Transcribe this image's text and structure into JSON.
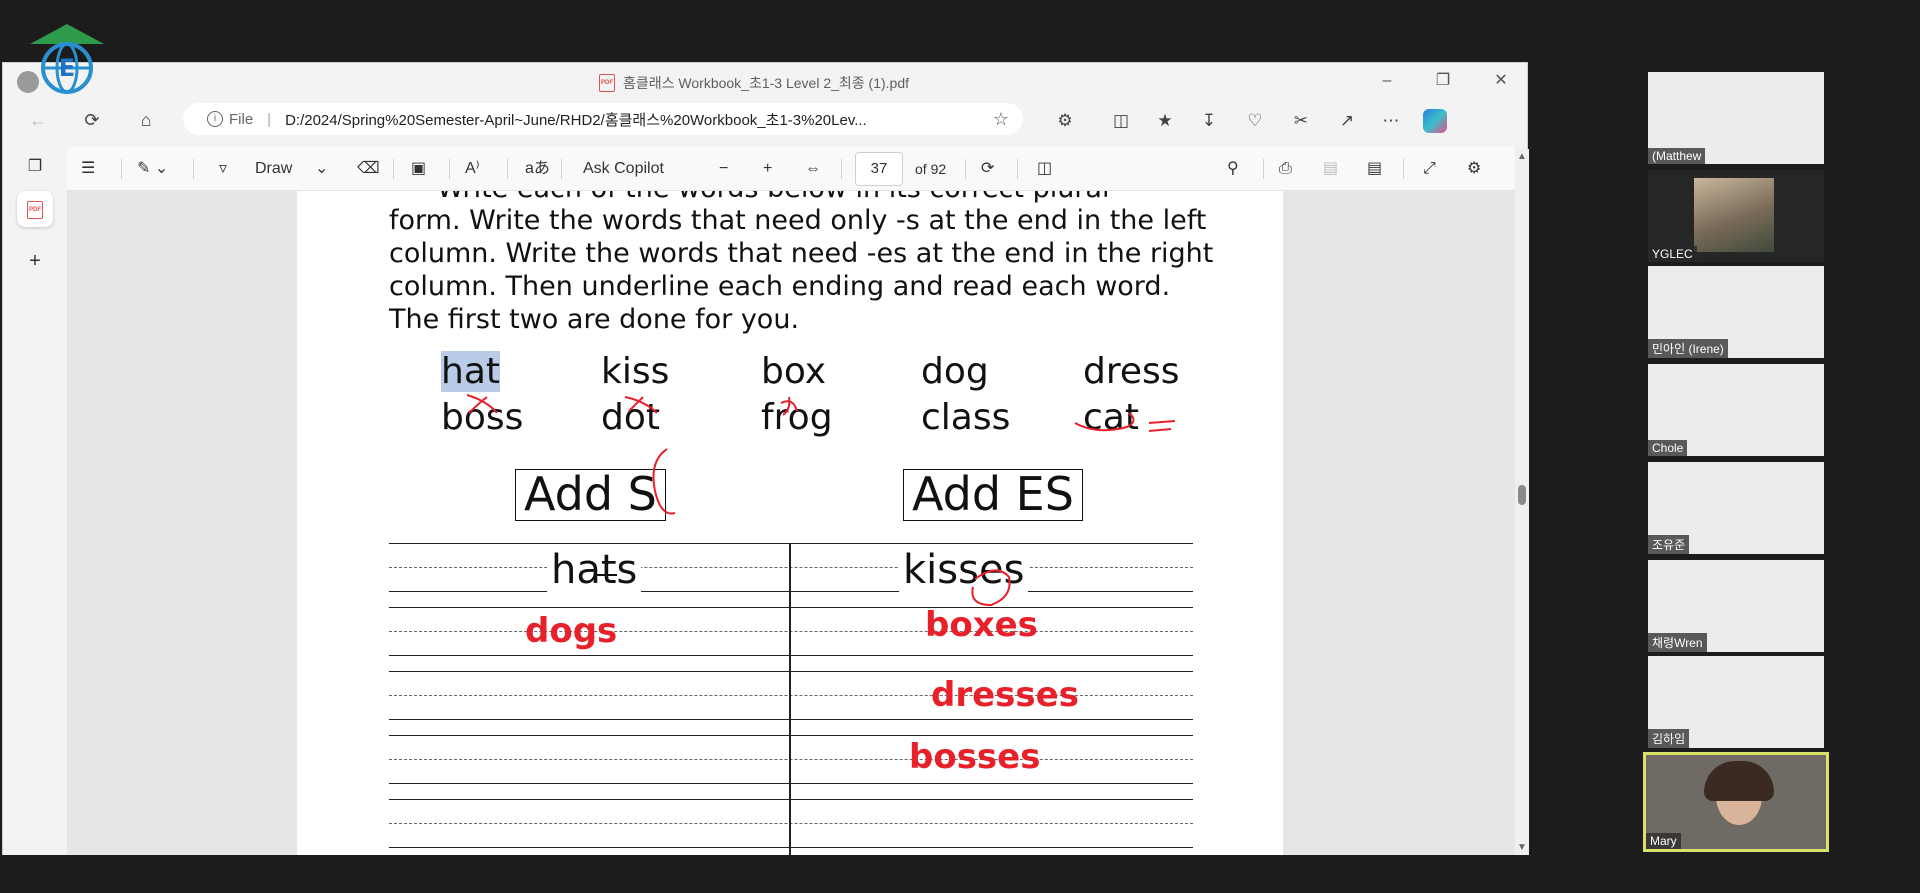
{
  "browser": {
    "tab_title": "홈클래스 Workbook_초1-3 Level 2_최종 (1).pdf",
    "url_prefix": "File",
    "url": "D:/2024/Spring%20Semester-April~June/RHD2/홈클래스%20Workbook_초1-3%20Lev..."
  },
  "pdf_toolbar": {
    "draw_label": "Draw",
    "copilot_label": "Ask Copilot",
    "page_number": "37",
    "page_total": "of 92"
  },
  "document": {
    "instructions": [
      "Write each of the words below in its correct plural",
      "form. Write the words that need only -s at the end in the left",
      "column. Write the words that need -es at the end in the right",
      "column. Then underline each ending and read each word.",
      "The first two are done for you."
    ],
    "words_row1": [
      "hat",
      "kiss",
      "box",
      "dog",
      "dress"
    ],
    "words_row2": [
      "boss",
      "dot",
      "frog",
      "class",
      "cat"
    ],
    "box_s": "Add S",
    "box_es": "Add ES",
    "example_left": "hats",
    "example_right": "kisses",
    "answers_left": [
      "dogs"
    ],
    "answers_right": [
      "boxes",
      "dresses",
      "bosses"
    ]
  },
  "participants": [
    {
      "name": "(Matthew"
    },
    {
      "name": "YGLEC"
    },
    {
      "name": "민아인 (Irene)"
    },
    {
      "name": "Chole"
    },
    {
      "name": "조유준"
    },
    {
      "name": "채령Wren"
    },
    {
      "name": "김하임"
    },
    {
      "name": "Mary"
    }
  ],
  "colors": {
    "annotation_red": "#e8202a",
    "highlight": "#b9cbe6",
    "active_speaker_border": "#d8e26a"
  }
}
